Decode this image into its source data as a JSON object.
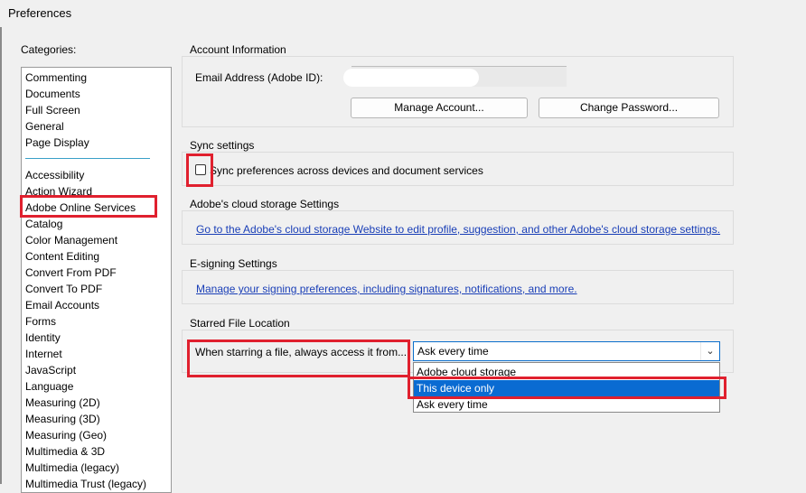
{
  "window": {
    "title": "Preferences"
  },
  "categories": {
    "label": "Categories:",
    "items": [
      "Commenting",
      "Documents",
      "Full Screen",
      "General",
      "Page Display",
      "Accessibility",
      "Action Wizard",
      "Adobe Online Services",
      "Catalog",
      "Color Management",
      "Content Editing",
      "Convert From PDF",
      "Convert To PDF",
      "Email Accounts",
      "Forms",
      "Identity",
      "Internet",
      "JavaScript",
      "Language",
      "Measuring (2D)",
      "Measuring (3D)",
      "Measuring (Geo)",
      "Multimedia & 3D",
      "Multimedia (legacy)",
      "Multimedia Trust (legacy)"
    ],
    "selected": "Adobe Online Services"
  },
  "account": {
    "group_label": "Account Information",
    "email_label": "Email Address (Adobe ID):",
    "manage_button": "Manage Account...",
    "change_password_button": "Change Password..."
  },
  "sync": {
    "group_label": "Sync settings",
    "checkbox_label": "Sync preferences across devices and document services",
    "checked": false
  },
  "cloud": {
    "group_label": "Adobe's cloud storage Settings",
    "link": "Go to the Adobe's cloud storage Website to edit profile, suggestion, and other Adobe's cloud storage settings."
  },
  "esign": {
    "group_label": "E-signing Settings",
    "link": "Manage your signing preferences, including signatures, notifications, and more."
  },
  "starred": {
    "group_label": "Starred File Location",
    "field_label": "When starring a file, always access it from...",
    "selected_value": "Ask every time",
    "options": [
      "Adobe cloud storage",
      "This device only",
      "Ask every time"
    ],
    "highlighted_option": "This device only"
  },
  "colors": {
    "highlight": "#e0202e",
    "selection": "#0a6bd2",
    "link": "#1a3fb7"
  }
}
